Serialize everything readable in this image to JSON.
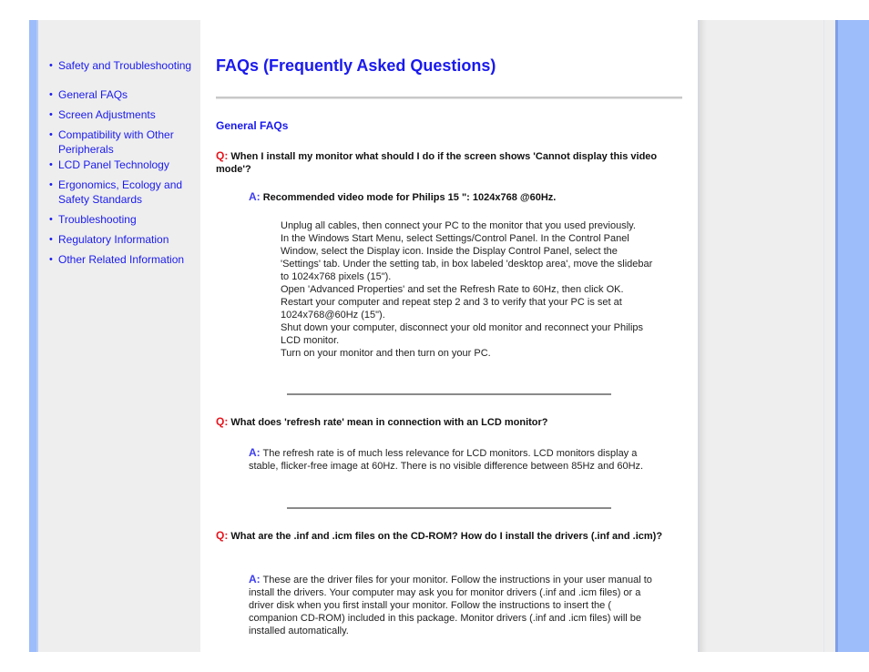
{
  "sidebar": {
    "items": [
      {
        "label": "Safety and Troubleshooting"
      },
      {
        "label": "General FAQs"
      },
      {
        "label": "Screen Adjustments"
      },
      {
        "label": "Compatibility with Other Peripherals"
      },
      {
        "label": "LCD Panel Technology"
      },
      {
        "label": "Ergonomics, Ecology and Safety Standards"
      },
      {
        "label": "Troubleshooting"
      },
      {
        "label": "Regulatory Information"
      },
      {
        "label": "Other Related Information"
      }
    ]
  },
  "main": {
    "title": "FAQs (Frequently Asked Questions)",
    "section_heading": "General FAQs",
    "q_label": "Q:",
    "a_label": "A:",
    "faqs": [
      {
        "question": "When I install my monitor what should I do if the screen shows 'Cannot display this video mode'?",
        "answer": "Recommended video mode for Philips 15 \": 1024x768 @60Hz.",
        "steps": [
          "Unplug all cables, then connect your PC to the monitor that you used previously.",
          "In the Windows Start Menu, select Settings/Control Panel. In the Control Panel Window, select the Display icon. Inside the Display Control Panel, select the 'Settings' tab. Under the setting tab, in box labeled 'desktop area', move the slidebar to 1024x768 pixels (15\").",
          "Open 'Advanced Properties' and set the Refresh Rate to 60Hz, then click OK.",
          "Restart your computer and repeat step 2 and 3 to verify that your PC is set at 1024x768@60Hz (15\").",
          "Shut down your computer, disconnect your old monitor and reconnect your Philips LCD monitor.",
          "Turn on your monitor and then turn on your PC."
        ]
      },
      {
        "question": "What does 'refresh rate' mean in connection with an LCD monitor?",
        "answer": "The refresh rate is of much less relevance for LCD monitors. LCD monitors display a stable, flicker-free image at 60Hz. There is no visible difference between 85Hz and 60Hz."
      },
      {
        "question": "What are the .inf and .icm files on the CD-ROM? How do I install the drivers (.inf and .icm)?",
        "answer": "These are the driver files for your monitor. Follow the instructions in your user manual to install the drivers. Your computer may ask you for monitor drivers (.inf and .icm files) or a driver disk when you first install your monitor. Follow the instructions to insert the ( companion CD-ROM) included in this package. Monitor drivers (.inf and .icm files) will be installed automatically."
      }
    ]
  },
  "colors": {
    "link": "#1a1aee",
    "q_label": "#e8141c",
    "a_label": "#3c3cf0",
    "frame_blue": "#9dbcfa",
    "panel_gray": "#eeeeee"
  }
}
